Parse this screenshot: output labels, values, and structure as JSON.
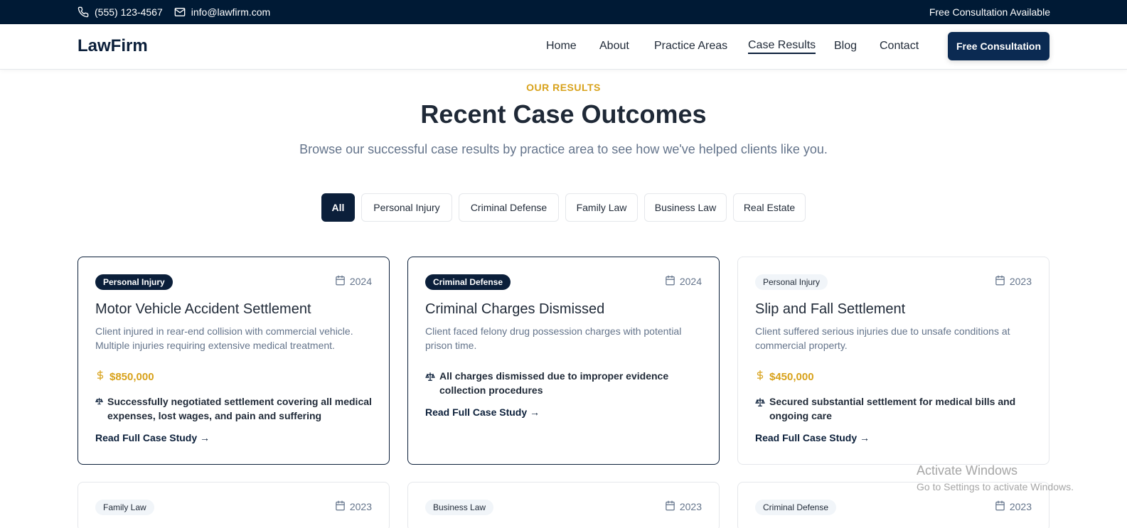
{
  "topbar": {
    "phone": "(555) 123-4567",
    "email": "info@lawfirm.com",
    "consultation_note": "Free Consultation Available"
  },
  "nav": {
    "logo": "LawFirm",
    "links": [
      "Home",
      "About",
      "Practice Areas",
      "Case Results",
      "Blog",
      "Contact"
    ],
    "active": "Case Results",
    "cta": "Free Consultation"
  },
  "hero": {
    "eyebrow": "OUR RESULTS",
    "title": "Recent Case Outcomes",
    "subtitle": "Browse our successful case results by practice area to see how we've helped clients like you."
  },
  "filters": {
    "items": [
      "All",
      "Personal Injury",
      "Criminal Defense",
      "Family Law",
      "Business Law",
      "Real Estate"
    ],
    "active": "All"
  },
  "cards": [
    {
      "category": "Personal Injury",
      "year": "2024",
      "title": "Motor Vehicle Accident Settlement",
      "description": "Client injured in rear-end collision with commercial vehicle. Multiple injuries requiring extensive medical treatment.",
      "amount": "$850,000",
      "outcome": "Successfully negotiated settlement covering all medical expenses, lost wages, and pain and suffering",
      "link": "Read Full Case Study →"
    },
    {
      "category": "Criminal Defense",
      "year": "2024",
      "title": "Criminal Charges Dismissed",
      "description": "Client faced felony drug possession charges with potential prison time.",
      "outcome": "All charges dismissed due to improper evidence collection procedures",
      "link": "Read Full Case Study →"
    },
    {
      "category": "Personal Injury",
      "year": "2023",
      "title": "Slip and Fall Settlement",
      "description": "Client suffered serious injuries due to unsafe conditions at commercial property.",
      "amount": "$450,000",
      "outcome": "Secured substantial settlement for medical bills and ongoing care",
      "link": "Read Full Case Study →"
    },
    {
      "category": "Family Law",
      "year": "2023"
    },
    {
      "category": "Business Law",
      "year": "2023"
    },
    {
      "category": "Criminal Defense",
      "year": "2023"
    }
  ],
  "watermark": {
    "line1": "Activate Windows",
    "line2": "Go to Settings to activate Windows."
  },
  "colors": {
    "navy": "#0b1f3a",
    "topbar": "#001a35",
    "gold": "#d8a21b",
    "muted": "#64748b"
  },
  "icons": [
    "phone-icon",
    "mail-icon",
    "calendar-icon",
    "dollar-icon",
    "scale-icon"
  ]
}
